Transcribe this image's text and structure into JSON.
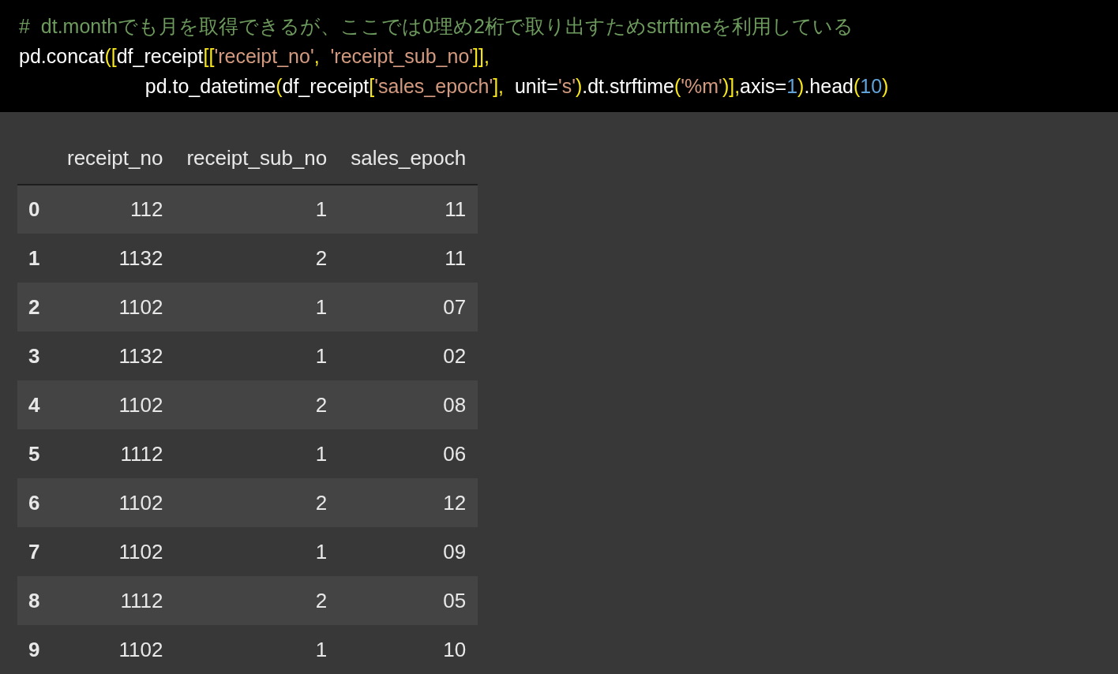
{
  "code_cell": {
    "lines": [
      [
        {
          "kind": "comment",
          "text": "#  dt.monthでも月を取得できるが、ここでは0埋め2桁で取り出すためstrftimeを利用している"
        }
      ],
      [
        {
          "kind": "plain",
          "text": "pd.concat"
        },
        {
          "kind": "bracket",
          "text": "(["
        },
        {
          "kind": "plain",
          "text": "df_receipt"
        },
        {
          "kind": "bracket",
          "text": "[["
        },
        {
          "kind": "string",
          "text": "'receipt_no'"
        },
        {
          "kind": "bracket",
          "text": ","
        },
        {
          "kind": "string",
          "text": "  'receipt_sub_no'"
        },
        {
          "kind": "bracket",
          "text": "]],"
        }
      ],
      [
        {
          "kind": "plain",
          "text": "                       pd.to_datetime"
        },
        {
          "kind": "bracket",
          "text": "("
        },
        {
          "kind": "plain",
          "text": "df_receipt"
        },
        {
          "kind": "bracket",
          "text": "["
        },
        {
          "kind": "string",
          "text": "'sales_epoch'"
        },
        {
          "kind": "bracket",
          "text": "],"
        },
        {
          "kind": "plain",
          "text": "  unit="
        },
        {
          "kind": "string",
          "text": "'s'"
        },
        {
          "kind": "bracket",
          "text": ")"
        },
        {
          "kind": "plain",
          "text": ".dt.strftime"
        },
        {
          "kind": "bracket",
          "text": "("
        },
        {
          "kind": "string",
          "text": "'%m'"
        },
        {
          "kind": "bracket",
          "text": ")],"
        },
        {
          "kind": "plain",
          "text": "axis="
        },
        {
          "kind": "number",
          "text": "1"
        },
        {
          "kind": "bracket",
          "text": ")"
        },
        {
          "kind": "plain",
          "text": ".head"
        },
        {
          "kind": "bracket",
          "text": "("
        },
        {
          "kind": "number",
          "text": "10"
        },
        {
          "kind": "bracket",
          "text": ")"
        }
      ]
    ]
  },
  "table": {
    "columns": [
      "receipt_no",
      "receipt_sub_no",
      "sales_epoch"
    ],
    "rows": [
      {
        "index": "0",
        "cells": [
          "112",
          "1",
          "11"
        ]
      },
      {
        "index": "1",
        "cells": [
          "1132",
          "2",
          "11"
        ]
      },
      {
        "index": "2",
        "cells": [
          "1102",
          "1",
          "07"
        ]
      },
      {
        "index": "3",
        "cells": [
          "1132",
          "1",
          "02"
        ]
      },
      {
        "index": "4",
        "cells": [
          "1102",
          "2",
          "08"
        ]
      },
      {
        "index": "5",
        "cells": [
          "1112",
          "1",
          "06"
        ]
      },
      {
        "index": "6",
        "cells": [
          "1102",
          "2",
          "12"
        ]
      },
      {
        "index": "7",
        "cells": [
          "1102",
          "1",
          "09"
        ]
      },
      {
        "index": "8",
        "cells": [
          "1112",
          "2",
          "05"
        ]
      },
      {
        "index": "9",
        "cells": [
          "1102",
          "1",
          "10"
        ]
      }
    ]
  }
}
